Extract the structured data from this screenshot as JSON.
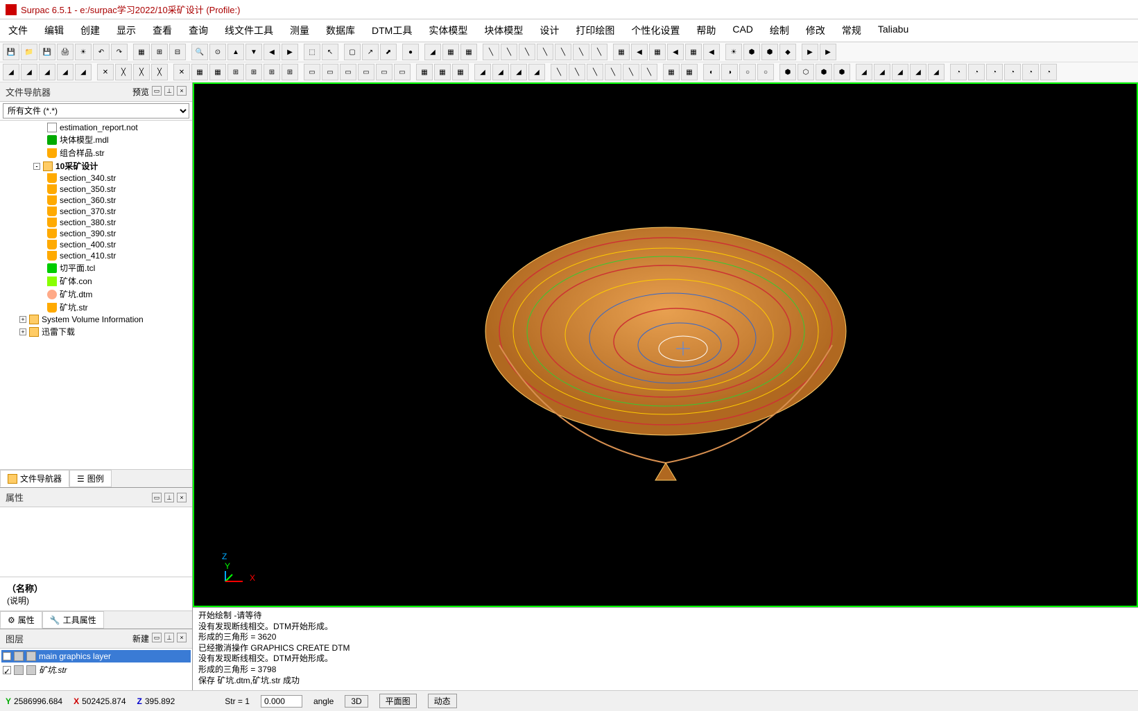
{
  "title": "Surpac 6.5.1 - e:/surpac学习2022/10采矿设计 (Profile:)",
  "menu": [
    "文件",
    "编辑",
    "创建",
    "显示",
    "查看",
    "查询",
    "线文件工具",
    "测量",
    "数据库",
    "DTM工具",
    "实体模型",
    "块体模型",
    "设计",
    "打印绘图",
    "个性化设置",
    "帮助",
    "CAD",
    "绘制",
    "修改",
    "常规",
    "Taliabu"
  ],
  "navigator": {
    "title": "文件导航器",
    "preview": "预览",
    "filter": "所有文件 (*.*)",
    "items": [
      {
        "indent": 60,
        "icon": "ic-file",
        "label": "estimation_report.not"
      },
      {
        "indent": 60,
        "icon": "ic-mdl",
        "label": "块体模型.mdl"
      },
      {
        "indent": 60,
        "icon": "ic-str",
        "label": "组合样品.str"
      },
      {
        "indent": 40,
        "icon": "ic-folder",
        "label": "10采矿设计",
        "bold": true,
        "expander": "-"
      },
      {
        "indent": 60,
        "icon": "ic-str",
        "label": "section_340.str"
      },
      {
        "indent": 60,
        "icon": "ic-str",
        "label": "section_350.str"
      },
      {
        "indent": 60,
        "icon": "ic-str",
        "label": "section_360.str"
      },
      {
        "indent": 60,
        "icon": "ic-str",
        "label": "section_370.str"
      },
      {
        "indent": 60,
        "icon": "ic-str",
        "label": "section_380.str"
      },
      {
        "indent": 60,
        "icon": "ic-str",
        "label": "section_390.str"
      },
      {
        "indent": 60,
        "icon": "ic-str",
        "label": "section_400.str"
      },
      {
        "indent": 60,
        "icon": "ic-str",
        "label": "section_410.str"
      },
      {
        "indent": 60,
        "icon": "ic-tcl",
        "label": "切平面.tcl"
      },
      {
        "indent": 60,
        "icon": "ic-con",
        "label": "矿体.con"
      },
      {
        "indent": 60,
        "icon": "ic-dtm",
        "label": "矿坑.dtm"
      },
      {
        "indent": 60,
        "icon": "ic-str",
        "label": "矿坑.str"
      },
      {
        "indent": 20,
        "icon": "ic-folder",
        "label": "System Volume Information",
        "expander": "+"
      },
      {
        "indent": 20,
        "icon": "ic-folder",
        "label": "迅雷下载",
        "expander": "+"
      }
    ],
    "tabs": {
      "nav": "文件导航器",
      "legend": "图例"
    }
  },
  "properties": {
    "title": "属性",
    "name_label": "（名称）",
    "desc_label": "(说明)",
    "tabs": {
      "props": "属性",
      "toolprops": "工具属性"
    }
  },
  "layers": {
    "title": "图层",
    "new_btn": "新建",
    "items": [
      {
        "label": "main graphics layer",
        "selected": true,
        "checked": false
      },
      {
        "label": "矿坑.str",
        "selected": false,
        "checked": true,
        "italic": true
      }
    ]
  },
  "axis": {
    "z": "Z",
    "y": "Y",
    "x": "X"
  },
  "console": [
    "开始绘制 -请等待",
    "没有发现断线相交。DTM开始形成。",
    "形成的三角形 = 3620",
    "已经撤消操作 GRAPHICS CREATE DTM",
    "没有发现断线相交。DTM开始形成。",
    "形成的三角形 = 3798",
    "保存 矿坑.dtm,矿坑.str 成功"
  ],
  "status": {
    "y": "2586996.684",
    "x": "502425.874",
    "z": "395.892",
    "str_label": "Str = 1",
    "str_val": "0.000",
    "angle": "angle",
    "mode3d": "3D",
    "plan": "平面图",
    "dynamic": "动态"
  }
}
